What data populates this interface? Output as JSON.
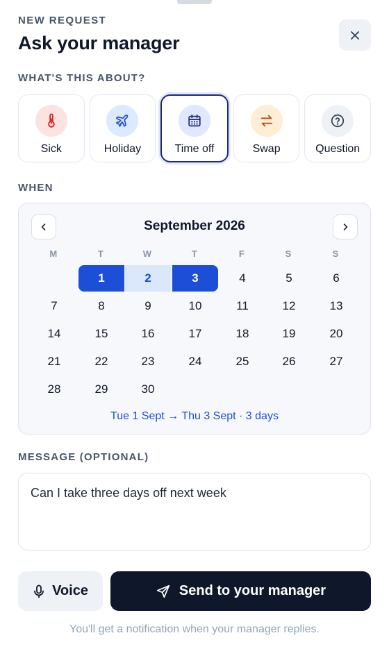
{
  "header": {
    "eyebrow": "NEW REQUEST",
    "title": "Ask your manager"
  },
  "categories": {
    "label": "WHAT'S THIS ABOUT?",
    "selected": "Time off",
    "items": [
      {
        "label": "Sick",
        "icon": "thermometer-icon",
        "bg": "#fde2e2",
        "color": "#dc2626"
      },
      {
        "label": "Holiday",
        "icon": "plane-icon",
        "bg": "#dbeafe",
        "color": "#1d4ed8"
      },
      {
        "label": "Time off",
        "icon": "calendar-icon",
        "bg": "#e0e7ff",
        "color": "#1e2a78"
      },
      {
        "label": "Swap",
        "icon": "swap-icon",
        "bg": "#ffedd5",
        "color": "#c2410c"
      },
      {
        "label": "Question",
        "icon": "question-icon",
        "bg": "#eef2f6",
        "color": "#334155"
      }
    ]
  },
  "when": {
    "label": "WHEN",
    "month": "September 2026",
    "weekdays": [
      "M",
      "T",
      "W",
      "T",
      "F",
      "S",
      "S"
    ],
    "days": [
      [
        null,
        "1",
        "2",
        "3",
        "4",
        "5",
        "6"
      ],
      [
        "7",
        "8",
        "9",
        "10",
        "11",
        "12",
        "13"
      ],
      [
        "14",
        "15",
        "16",
        "17",
        "18",
        "19",
        "20"
      ],
      [
        "21",
        "22",
        "23",
        "24",
        "25",
        "26",
        "27"
      ],
      [
        "28",
        "29",
        "30",
        null,
        null,
        null,
        null
      ]
    ],
    "range_start": "1",
    "range_end": "3",
    "summary": "Tue 1 Sept → Thu 3 Sept · 3 days"
  },
  "message": {
    "label": "MESSAGE (OPTIONAL)",
    "value": "Can I take three days off next week"
  },
  "actions": {
    "voice_label": "Voice",
    "send_label": "Send to your manager"
  },
  "footnote": "You'll get a notification when your manager replies."
}
